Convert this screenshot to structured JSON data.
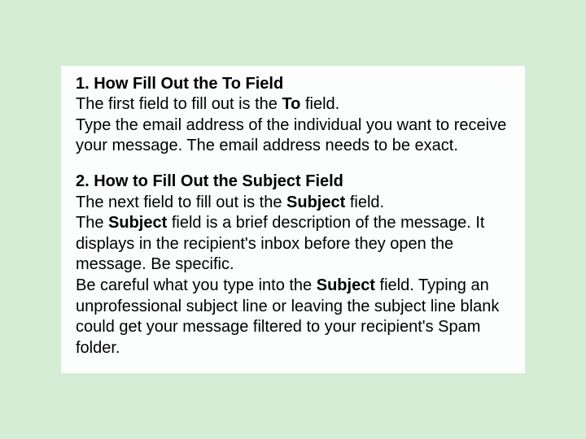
{
  "sections": [
    {
      "heading": "1. How Fill Out the To Field",
      "lines": [
        [
          {
            "t": "The first field to fill out is the "
          },
          {
            "t": "To",
            "b": true
          },
          {
            "t": " field."
          }
        ],
        [
          {
            "t": "Type the email address of the individual you want to receive your message. The email address needs to be exact."
          }
        ]
      ]
    },
    {
      "heading": "2. How to Fill Out the Subject Field",
      "lines": [
        [
          {
            "t": "The next field to fill out is the "
          },
          {
            "t": "Subject",
            "b": true
          },
          {
            "t": " field."
          }
        ],
        [
          {
            "t": "The "
          },
          {
            "t": "Subject",
            "b": true
          },
          {
            "t": " field is a brief description of the message. It displays in the recipient's inbox before they open the message. Be specific."
          }
        ],
        [
          {
            "t": "Be careful what you type into the "
          },
          {
            "t": "Subject",
            "b": true
          },
          {
            "t": " field. Typing an unprofessional subject line or leaving the subject line blank could get your message filtered to your recipient's Spam folder."
          }
        ]
      ]
    }
  ]
}
